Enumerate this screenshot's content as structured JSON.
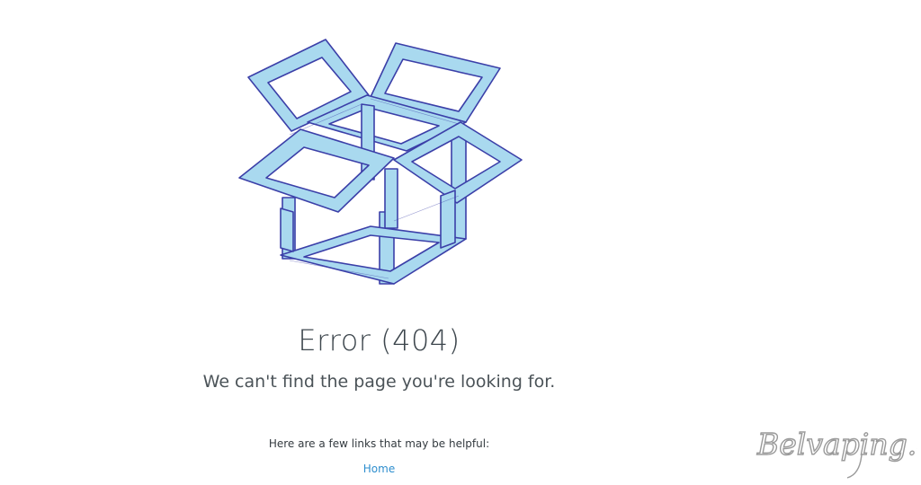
{
  "error": {
    "title": "Error (404)",
    "subtitle": "We can't find the page you're looking for.",
    "helpful_text": "Here are a few links that may be helpful:"
  },
  "links": {
    "home": "Home"
  },
  "watermark": {
    "text": "Belvaping.com"
  },
  "colors": {
    "box_fill": "#a9d9ef",
    "box_stroke": "#3b3fa8",
    "link": "#2e8ece",
    "title": "#3d464d"
  },
  "icons": {
    "illustration": "impossible-open-box-illustration"
  }
}
